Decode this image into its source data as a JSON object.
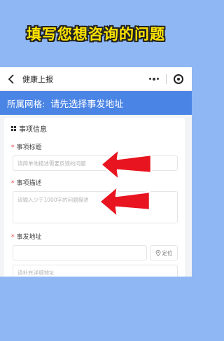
{
  "banner": {
    "title": "填写您想咨询的问题"
  },
  "navbar": {
    "title": "健康上报"
  },
  "grid": {
    "label": "所属网格:",
    "value": "请先选择事发地址"
  },
  "form": {
    "section_title": "事项信息",
    "title_field": {
      "label": "事项标题",
      "placeholder": "请简单地描述需要反馈的问题"
    },
    "desc_field": {
      "label": "事项描述",
      "placeholder": "请输入少于1000字的问题描述"
    },
    "addr_field": {
      "label": "事发地址",
      "value": "",
      "locate_label": "定位"
    },
    "detail_field": {
      "placeholder": "请补充详细地址"
    }
  },
  "colors": {
    "accent": "#4a84e5",
    "banner_text": "#ffe400",
    "arrow": "#e8141f",
    "background": "#8fb7f3"
  },
  "icons": [
    "back-icon",
    "more-icon",
    "target-icon",
    "grid-icon",
    "location-pin-icon",
    "red-arrow-icon"
  ]
}
